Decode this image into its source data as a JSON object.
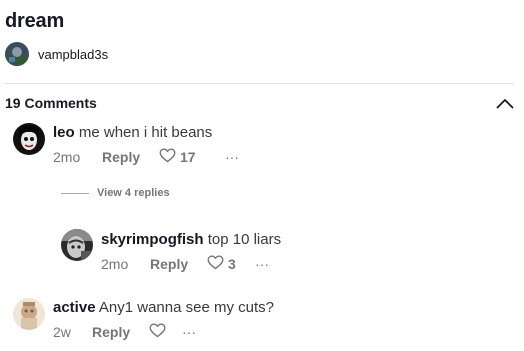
{
  "post": {
    "title": "dream",
    "author": "vampblad3s"
  },
  "comments_header": {
    "count_label": "19 Comments"
  },
  "comments": [
    {
      "user": "leo",
      "text": "me when i hit beans",
      "time": "2mo",
      "reply_label": "Reply",
      "likes": "17",
      "more": "···"
    },
    {
      "user": "skyrimpogfish",
      "text": "top 10 liars",
      "time": "2mo",
      "reply_label": "Reply",
      "likes": "3",
      "more": "···"
    },
    {
      "user": "active",
      "text": "Any1 wanna see my cuts?",
      "time": "2w",
      "reply_label": "Reply",
      "likes": "",
      "more": "···"
    }
  ],
  "view_replies_label": "View 4 replies",
  "icons": {
    "collapse": "chevron-up-icon",
    "like": "heart-outline-icon",
    "more": "ellipsis-icon"
  },
  "colors": {
    "text_primary": "#161823",
    "text_secondary": "#75767a",
    "divider": "#e3e3e4"
  }
}
